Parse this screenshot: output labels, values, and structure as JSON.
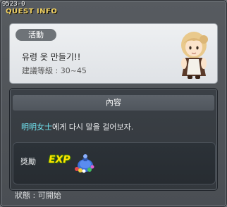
{
  "window": {
    "quest_id": "9523-0",
    "title": "QUEST INFO"
  },
  "summary": {
    "tag": "活動",
    "quest_name": "유령 옷 만들기!!",
    "level_requirement": "建議等級 : 30~45"
  },
  "content": {
    "header": "內容",
    "npc_name": "明明女士",
    "description": "에게 다시 말을 걸어보자."
  },
  "reward": {
    "label": "獎勵",
    "exp_label": "EXP",
    "item_icon": "gift-bag-icon"
  },
  "status": {
    "text": "狀態 : 可開始"
  }
}
